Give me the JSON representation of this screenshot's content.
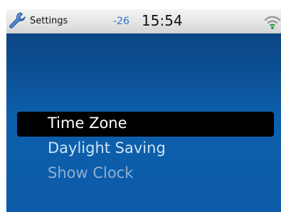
{
  "status_bar": {
    "title": "Settings",
    "signal_value": "-26",
    "time": "15:54",
    "left_icon": "wrench-icon",
    "right_icon": "wifi-icon",
    "wifi_color": "#2e9b3c"
  },
  "menu": {
    "items": [
      {
        "label": "Time Zone",
        "state": "selected"
      },
      {
        "label": "Daylight Saving",
        "state": "normal"
      },
      {
        "label": "Show Clock",
        "state": "disabled"
      }
    ]
  },
  "colors": {
    "background": "#0d5fac",
    "selection": "#000000",
    "status_bar": "#e3e3e3"
  }
}
